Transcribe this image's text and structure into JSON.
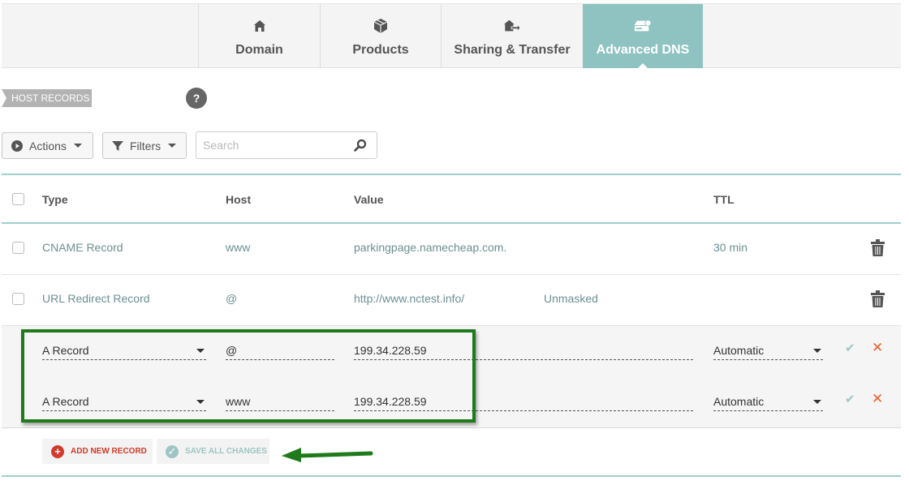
{
  "tabs": [
    {
      "label": "Domain",
      "icon": "home-icon"
    },
    {
      "label": "Products",
      "icon": "box-icon"
    },
    {
      "label": "Sharing & Transfer",
      "icon": "share-transfer-icon"
    },
    {
      "label": "Advanced DNS",
      "icon": "dns-server-icon",
      "active": true
    }
  ],
  "section": {
    "tag": "HOST RECORDS",
    "help": "?"
  },
  "toolbar": {
    "actions_label": "Actions",
    "filters_label": "Filters",
    "search_placeholder": "Search"
  },
  "table": {
    "headers": {
      "type": "Type",
      "host": "Host",
      "value": "Value",
      "ttl": "TTL"
    },
    "rows": [
      {
        "type": "CNAME Record",
        "host": "www",
        "value": "parkingpage.namecheap.com.",
        "extra": "",
        "ttl": "30 min"
      },
      {
        "type": "URL Redirect Record",
        "host": "@",
        "value": "http://www.nctest.info/",
        "extra": "Unmasked",
        "ttl": ""
      }
    ],
    "new_rows": [
      {
        "type": "A Record",
        "host": "@",
        "value": "199.34.228.59",
        "ttl": "Automatic"
      },
      {
        "type": "A Record",
        "host": "www",
        "value": "199.34.228.59",
        "ttl": "Automatic"
      }
    ]
  },
  "buttons": {
    "add": "ADD NEW RECORD",
    "save": "SAVE ALL CHANGES"
  },
  "colors": {
    "accent": "#8ec3c1",
    "highlight": "#1e7a1b",
    "danger": "#d23a2c"
  }
}
